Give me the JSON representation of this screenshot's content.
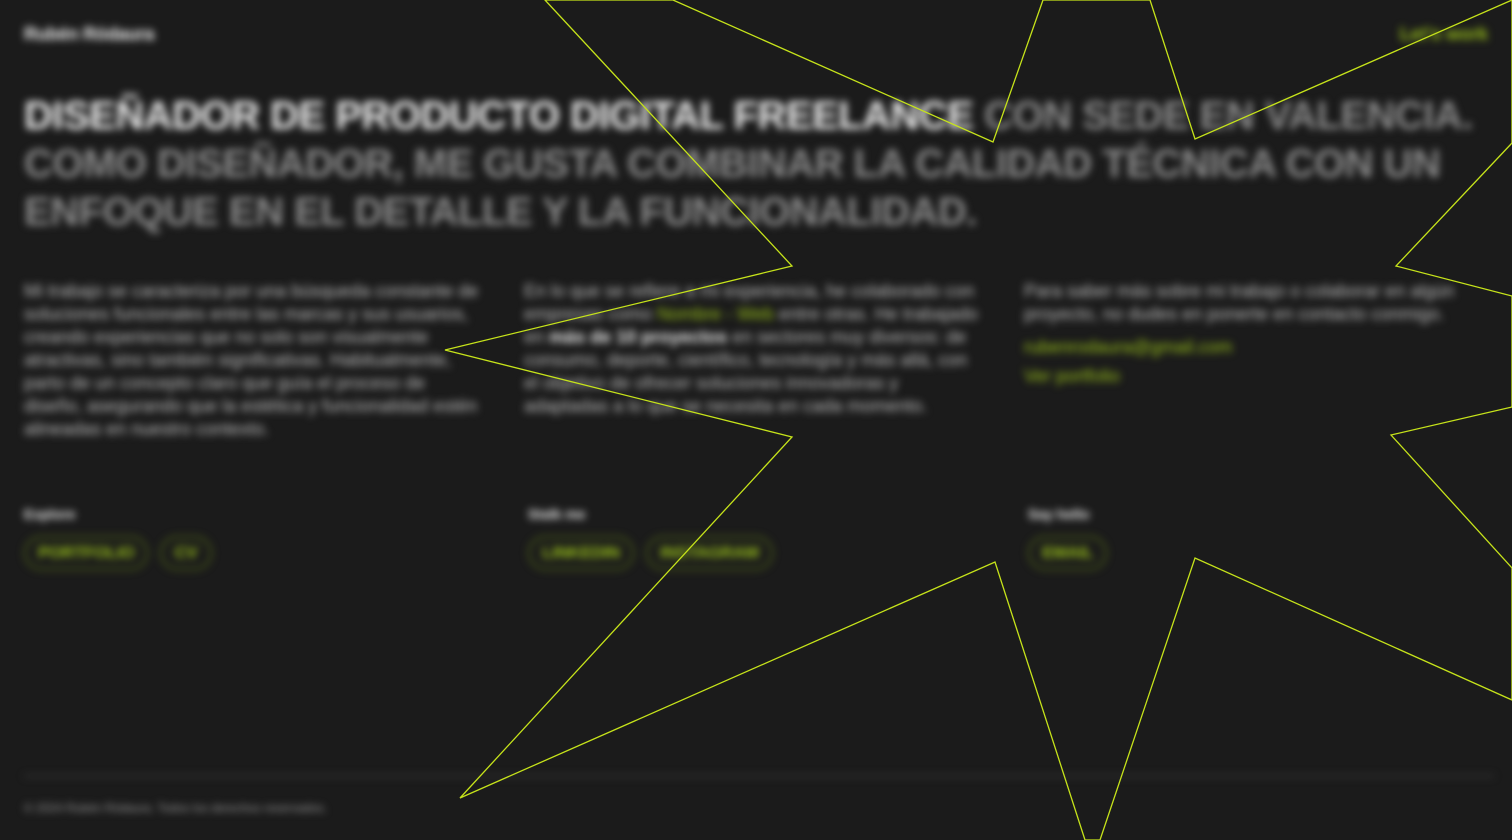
{
  "header": {
    "brand": "Rubén Ródaura",
    "top_link": "Let's work"
  },
  "hero": {
    "strong": "DISEÑADOR DE PRODUCTO DIGITAL FREELANCE",
    "muted": " CON SEDE EN VALENCIA. COMO DISEÑADOR, ME GUSTA COMBINAR LA CALIDAD TÉCNICA CON UN ENFOQUE EN EL DETALLE Y LA FUNCIONALIDAD."
  },
  "columns": {
    "col1": "Mi trabajo se caracteriza por una búsqueda constante de soluciones funcionales entre las marcas y sus usuarios, creando experiencias que no solo son visualmente atractivas, sino también significativas. Habitualmente, parto de un concepto claro que guía el proceso de diseño, asegurando que la estética y funcionalidad estén alineadas en nuestro contexto.",
    "col2": {
      "part1": "En lo que se refiere a mi experiencia, he colaborado con empresas como ",
      "accent": "Nombre - Web",
      "part2": " entre otras. He trabajado en ",
      "strong": "más de 10 proyectos",
      "part3": " en sectores muy diversos: de consumo, deporte, científico, tecnología y más allá, con el objetivo de ofrecer soluciones innovadoras y adaptadas a lo que se necesita en cada momento."
    },
    "col3": {
      "text": "Para saber más sobre mi trabajo o colaborar en algún proyecto, no dudes en ponerte en contacto conmigo.",
      "email": "rubenrodaura@gmail.com",
      "portfolio": "Ver portfolio"
    }
  },
  "groups": [
    {
      "title": "Explore",
      "pills": [
        "PORTFOLIO",
        "CV"
      ]
    },
    {
      "title": "Stalk me",
      "pills": [
        "LINKEDIN",
        "INSTAGRAM"
      ]
    },
    {
      "title": "Say hello",
      "pills": [
        "EMAIL"
      ]
    }
  ],
  "footer": {
    "text": "© 2024 Rubén Ródaura. Todos los derechos reservados."
  },
  "colors": {
    "background": "#1b1b1b",
    "accent": "#9ac21a",
    "star_stroke": "#c6e31a"
  }
}
